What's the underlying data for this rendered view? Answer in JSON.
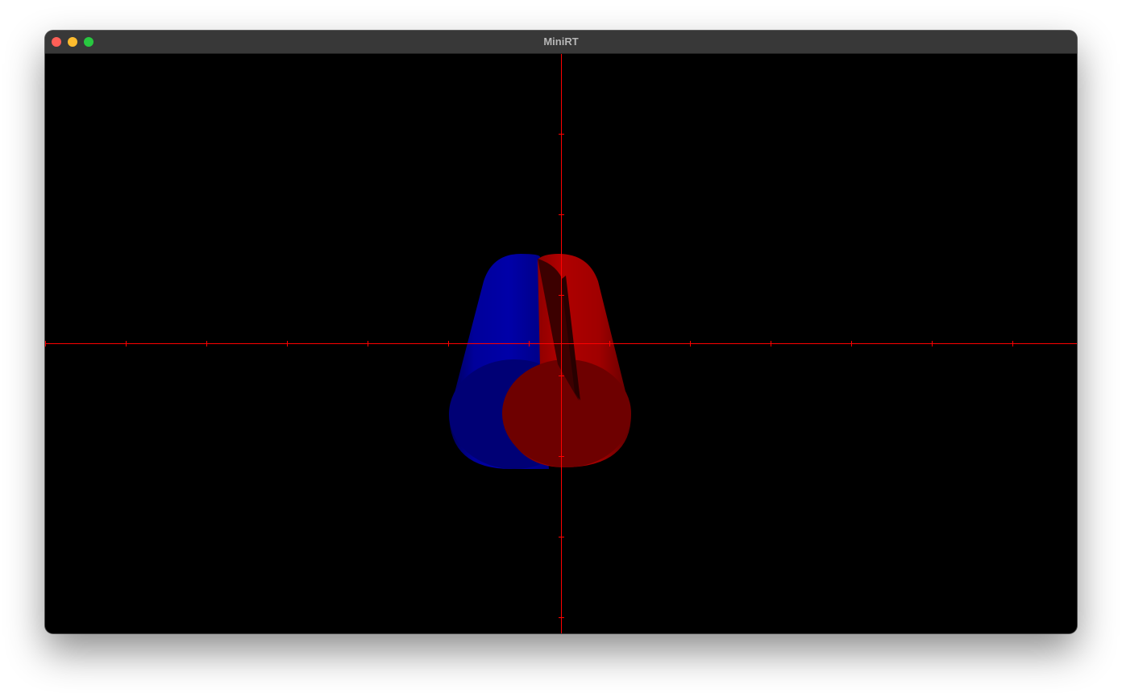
{
  "window": {
    "title": "MiniRT"
  },
  "scene": {
    "background_color": "#000000",
    "axis_color": "#ff0000",
    "objects": [
      {
        "type": "cylinder",
        "color": "#0000cc"
      },
      {
        "type": "cylinder",
        "color": "#cc0000"
      }
    ]
  }
}
